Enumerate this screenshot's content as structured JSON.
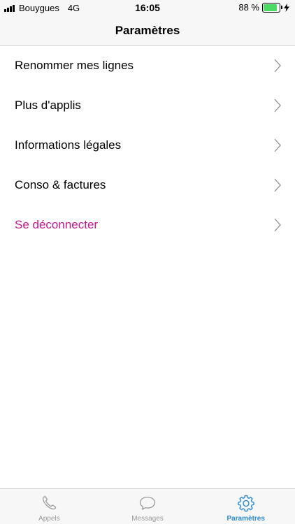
{
  "status_bar": {
    "carrier": "Bouygues",
    "network": "4G",
    "time": "16:05",
    "battery_percent": "88 %",
    "battery_level": 0.88,
    "battery_color": "#4cd964"
  },
  "nav": {
    "title": "Paramètres"
  },
  "settings": {
    "items": [
      {
        "label": "Renommer mes lignes",
        "icon": "chevron-right-icon"
      },
      {
        "label": "Plus d'applis",
        "icon": "chevron-right-icon"
      },
      {
        "label": "Informations légales",
        "icon": "chevron-right-icon"
      },
      {
        "label": "Conso & factures",
        "icon": "chevron-right-icon"
      },
      {
        "label": "Se déconnecter",
        "icon": "chevron-right-icon",
        "color": "#c6188e"
      }
    ]
  },
  "tab_bar": {
    "active_color": "#2a8bd5",
    "inactive_color": "#9a9a9a",
    "tabs": [
      {
        "label": "Appels",
        "icon": "phone-icon",
        "active": false
      },
      {
        "label": "Messages",
        "icon": "chat-bubble-icon",
        "active": false
      },
      {
        "label": "Paramètres",
        "icon": "gear-icon",
        "active": true
      }
    ]
  }
}
